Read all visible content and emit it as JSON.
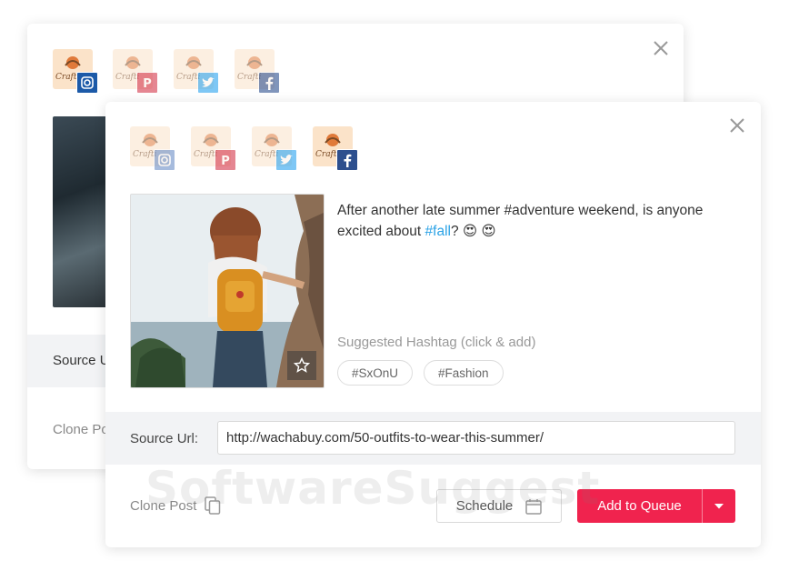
{
  "back_card": {
    "accounts": [
      {
        "network": "instagram",
        "brand": "Crafti",
        "active": true
      },
      {
        "network": "pinterest",
        "brand": "Crafti",
        "active": false
      },
      {
        "network": "twitter",
        "brand": "Crafti",
        "active": false
      },
      {
        "network": "facebook",
        "brand": "Crafti",
        "active": false
      }
    ],
    "source_label": "Source U",
    "clone_label": "Clone Po"
  },
  "front_card": {
    "accounts": [
      {
        "network": "instagram",
        "brand": "Crafti",
        "active": false
      },
      {
        "network": "pinterest",
        "brand": "Crafti",
        "active": false
      },
      {
        "network": "twitter",
        "brand": "Crafti",
        "active": false
      },
      {
        "network": "facebook",
        "brand": "Crafti",
        "active": true
      }
    ],
    "caption_text": "After another late summer #adventure weekend, is anyone excited about",
    "caption_hashtag": "#fall",
    "caption_tail": "? 😍 😍",
    "suggested_label": "Suggested Hashtag (click & add)",
    "suggested_hashtags": [
      "#SxOnU",
      "#Fashion"
    ],
    "source_label": "Source Url:",
    "source_url": "http://wachabuy.com/50-outfits-to-wear-this-summer/",
    "clone_label": "Clone Post",
    "schedule_label": "Schedule",
    "queue_label": "Add to Queue"
  },
  "watermark": "SoftwareSuggest",
  "colors": {
    "accent": "#f0234e",
    "hashtag_link": "#2aa2e6",
    "instagram": "#1c5aa8",
    "pinterest": "#d5364a",
    "twitter": "#29a3ef",
    "facebook": "#2d4f8e"
  }
}
